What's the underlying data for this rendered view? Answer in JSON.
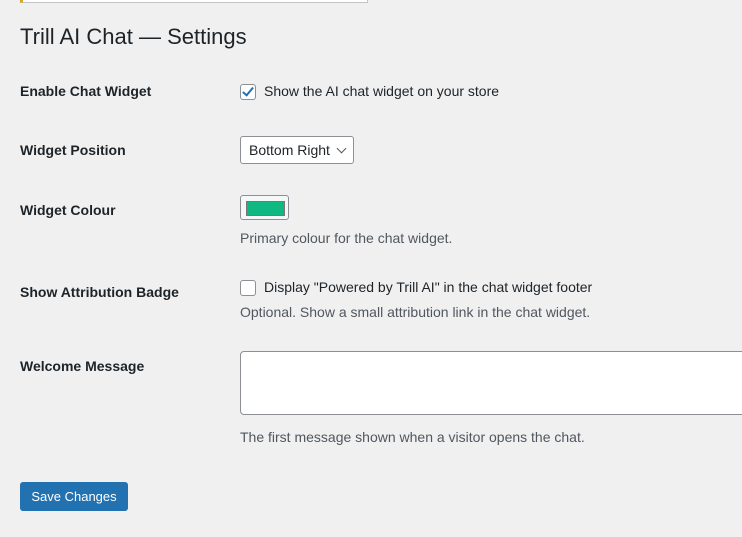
{
  "page": {
    "title": "Trill AI Chat — Settings"
  },
  "fields": {
    "enable": {
      "label": "Enable Chat Widget",
      "checkbox_label": "Show the AI chat widget on your store",
      "checked": true
    },
    "position": {
      "label": "Widget Position",
      "value": "Bottom Right"
    },
    "colour": {
      "label": "Widget Colour",
      "value": "#10b981",
      "description": "Primary colour for the chat widget."
    },
    "badge": {
      "label": "Show Attribution Badge",
      "checkbox_label": "Display \"Powered by Trill AI\" in the chat widget footer",
      "checked": false,
      "description": "Optional. Show a small attribution link in the chat widget."
    },
    "welcome": {
      "label": "Welcome Message",
      "value": "",
      "description": "The first message shown when a visitor opens the chat."
    }
  },
  "actions": {
    "save_label": "Save Changes"
  }
}
